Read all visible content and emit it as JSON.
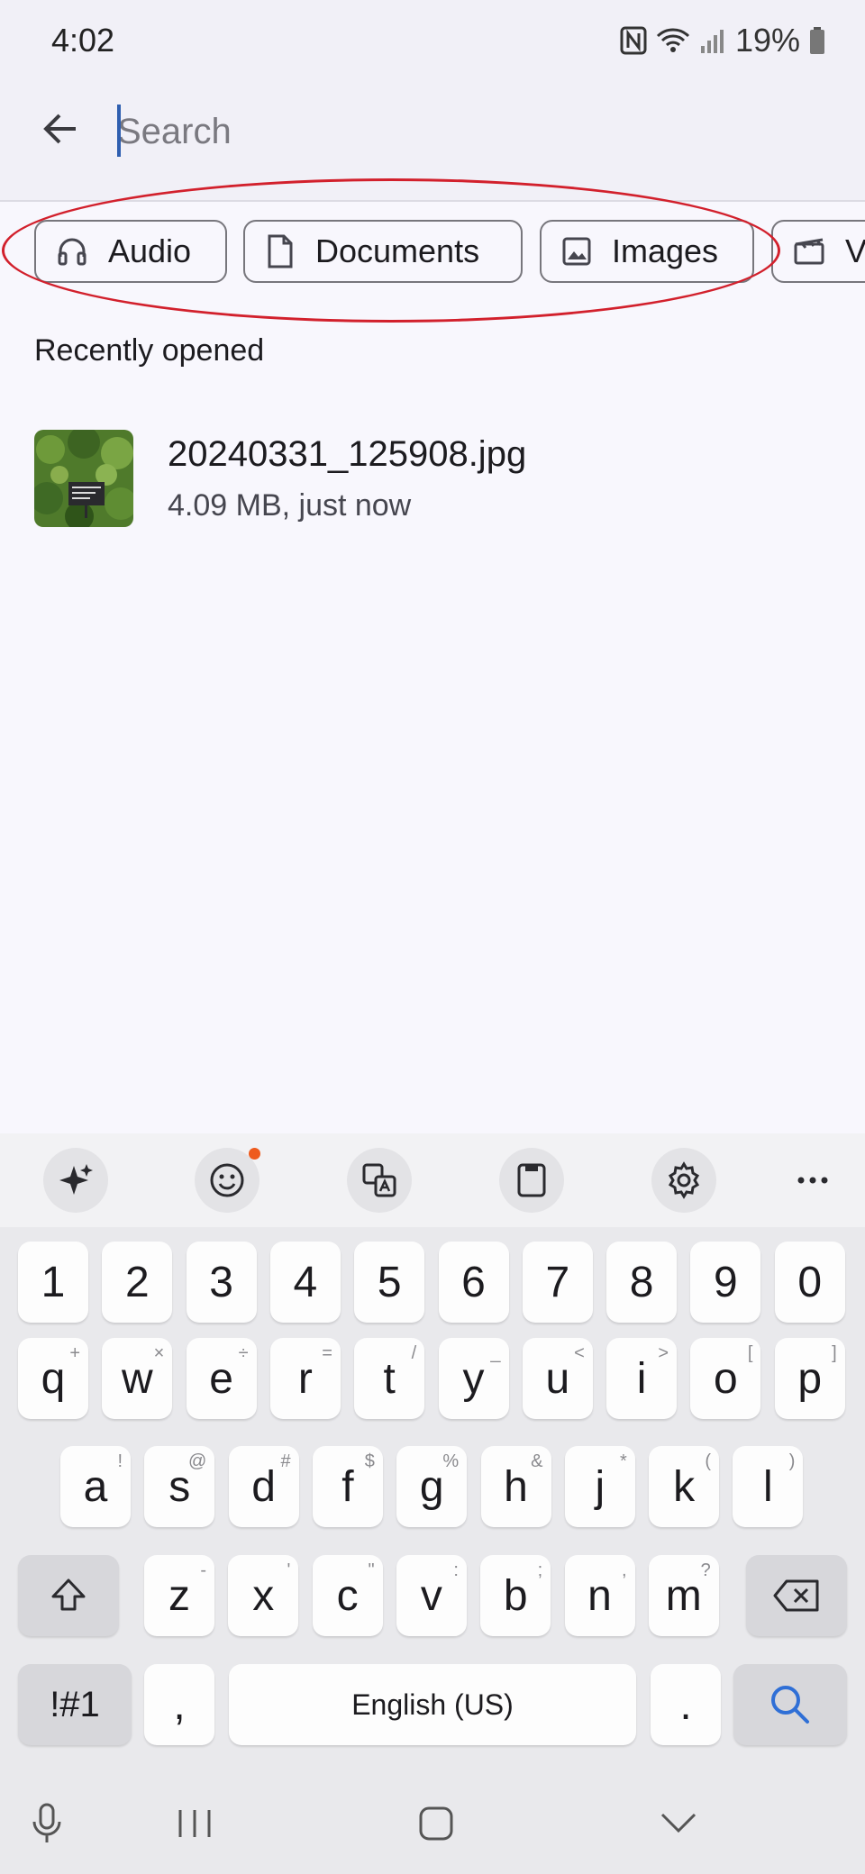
{
  "status_bar": {
    "time": "4:02",
    "battery": "19%"
  },
  "search": {
    "placeholder": "Search",
    "value": ""
  },
  "chips": [
    {
      "label": "Audio",
      "icon": "headphones-icon"
    },
    {
      "label": "Documents",
      "icon": "document-icon"
    },
    {
      "label": "Images",
      "icon": "image-icon"
    },
    {
      "label": "V",
      "icon": "video-icon"
    }
  ],
  "recent": {
    "heading": "Recently opened",
    "items": [
      {
        "name": "20240331_125908.jpg",
        "meta": "4.09 MB, just now"
      }
    ]
  },
  "keyboard": {
    "toolbar": [
      "sparkle-icon",
      "emoji-icon",
      "translate-icon",
      "clipboard-icon",
      "settings-icon",
      "more-icon"
    ],
    "row_numbers": [
      "1",
      "2",
      "3",
      "4",
      "5",
      "6",
      "7",
      "8",
      "9",
      "0"
    ],
    "row_q": [
      {
        "k": "q",
        "h": "+"
      },
      {
        "k": "w",
        "h": "×"
      },
      {
        "k": "e",
        "h": "÷"
      },
      {
        "k": "r",
        "h": "="
      },
      {
        "k": "t",
        "h": "/"
      },
      {
        "k": "y",
        "h": "_"
      },
      {
        "k": "u",
        "h": "<"
      },
      {
        "k": "i",
        "h": ">"
      },
      {
        "k": "o",
        "h": "["
      },
      {
        "k": "p",
        "h": "]"
      }
    ],
    "row_a": [
      {
        "k": "a",
        "h": "!"
      },
      {
        "k": "s",
        "h": "@"
      },
      {
        "k": "d",
        "h": "#"
      },
      {
        "k": "f",
        "h": "$"
      },
      {
        "k": "g",
        "h": "%"
      },
      {
        "k": "h",
        "h": "&"
      },
      {
        "k": "j",
        "h": "*"
      },
      {
        "k": "k",
        "h": "("
      },
      {
        "k": "l",
        "h": ")"
      }
    ],
    "row_z": [
      {
        "k": "z",
        "h": "-"
      },
      {
        "k": "x",
        "h": "'"
      },
      {
        "k": "c",
        "h": "\""
      },
      {
        "k": "v",
        "h": ":"
      },
      {
        "k": "b",
        "h": ";"
      },
      {
        "k": "n",
        "h": ","
      },
      {
        "k": "m",
        "h": "?"
      }
    ],
    "symbols_label": "!#1",
    "comma": ",",
    "space_label": "English (US)",
    "period": "."
  },
  "colors": {
    "annotation": "#d2202c",
    "accent": "#2f6fd6"
  }
}
